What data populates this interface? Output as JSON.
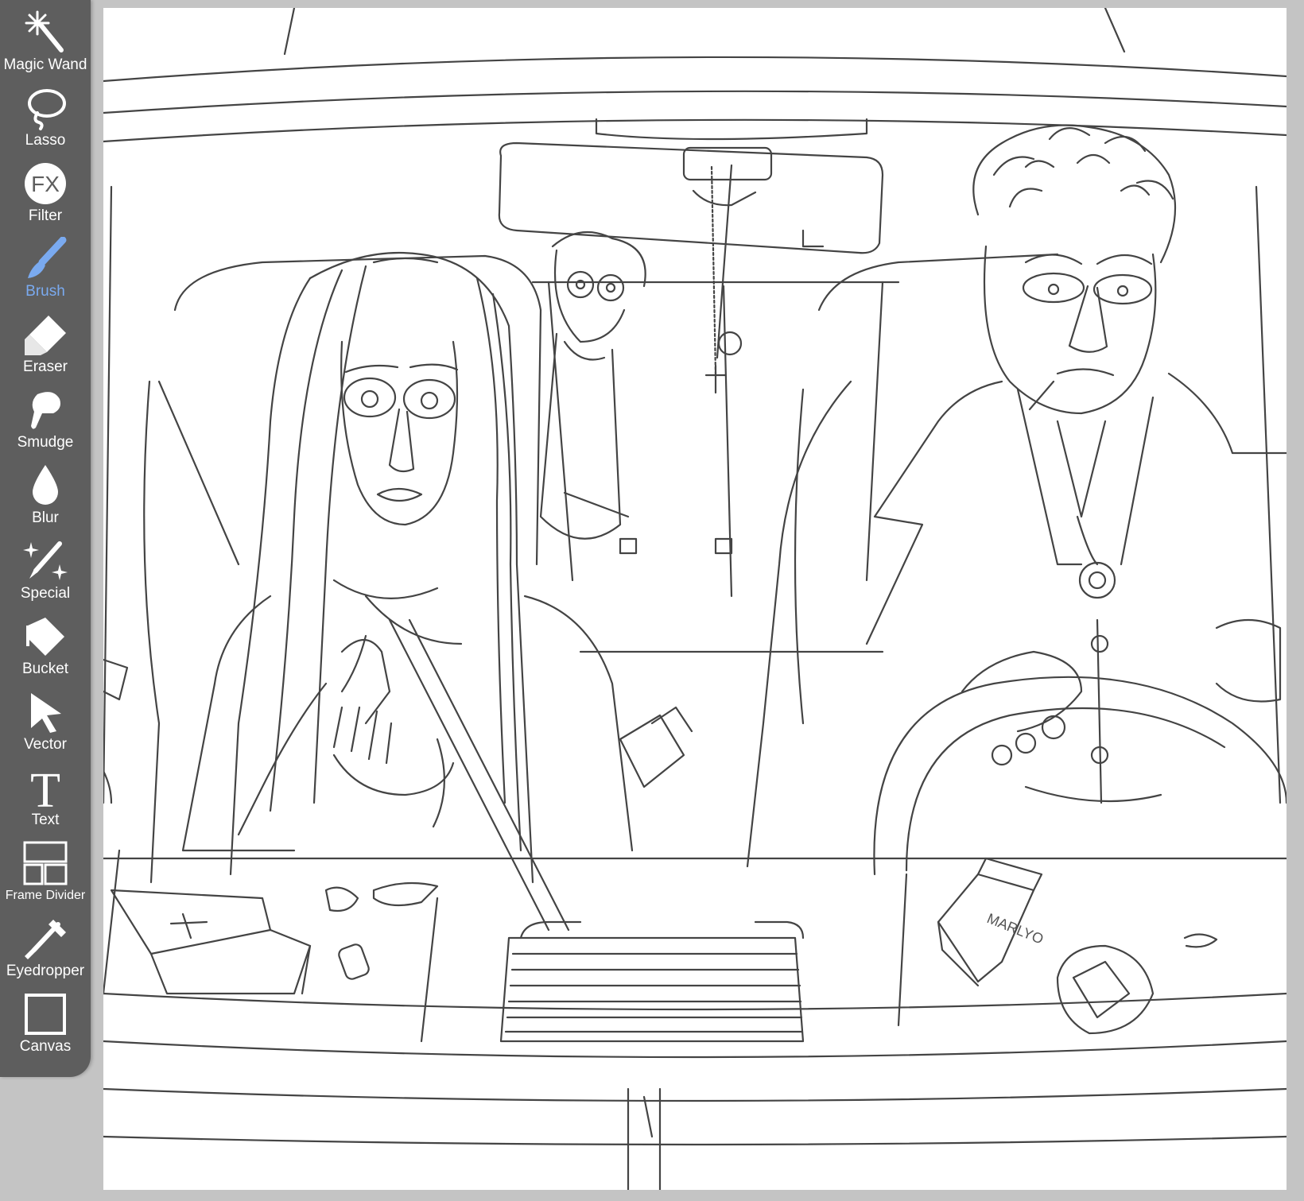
{
  "toolbar": {
    "active_tool": "Brush",
    "accent_color": "#7aaaf0",
    "tools": [
      {
        "label": "Magic Wand",
        "icon": "magic-wand-icon"
      },
      {
        "label": "Lasso",
        "icon": "lasso-icon"
      },
      {
        "label": "Filter",
        "icon": "fx-icon",
        "icon_text": "FX"
      },
      {
        "label": "Brush",
        "icon": "brush-icon"
      },
      {
        "label": "Eraser",
        "icon": "eraser-icon"
      },
      {
        "label": "Smudge",
        "icon": "smudge-icon"
      },
      {
        "label": "Blur",
        "icon": "drop-icon"
      },
      {
        "label": "Special",
        "icon": "special-icon"
      },
      {
        "label": "Bucket",
        "icon": "bucket-icon"
      },
      {
        "label": "Vector",
        "icon": "vector-arrow-icon"
      },
      {
        "label": "Text",
        "icon": "text-icon",
        "icon_text": "T"
      },
      {
        "label": "Frame Divider",
        "icon": "frame-divider-icon"
      },
      {
        "label": "Eyedropper",
        "icon": "eyedropper-icon"
      },
      {
        "label": "Canvas",
        "icon": "canvas-icon"
      }
    ]
  },
  "canvas": {
    "artwork": "car-interior-sketch",
    "cigarette_pack_text": "MARLYO"
  }
}
